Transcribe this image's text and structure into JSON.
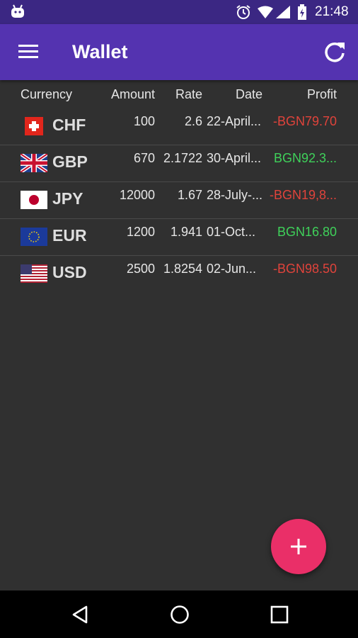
{
  "status_bar": {
    "time": "21:48",
    "icons": [
      "android-icon",
      "alarm-icon",
      "wifi-icon",
      "signal-icon",
      "battery-icon"
    ]
  },
  "app_bar": {
    "title": "Wallet",
    "menu_icon": "menu-icon",
    "refresh_icon": "refresh-icon"
  },
  "table": {
    "headers": {
      "currency": "Currency",
      "amount": "Amount",
      "rate": "Rate",
      "date": "Date",
      "profit": "Profit"
    },
    "rows": [
      {
        "flag": "swiss-flag-icon",
        "currency": "CHF",
        "amount": "100",
        "rate": "2.6",
        "date": "22-April...",
        "profit": "-BGN79.70",
        "profit_status": "negative"
      },
      {
        "flag": "uk-flag-icon",
        "currency": "GBP",
        "amount": "670",
        "rate": "2.1722",
        "date": "30-April...",
        "profit": "BGN92.3...",
        "profit_status": "positive"
      },
      {
        "flag": "japan-flag-icon",
        "currency": "JPY",
        "amount": "12000",
        "rate": "1.67",
        "date": "28-July-...",
        "profit": "-BGN19,8...",
        "profit_status": "negative"
      },
      {
        "flag": "eu-flag-icon",
        "currency": "EUR",
        "amount": "1200",
        "rate": "1.941",
        "date": "01-Oct...",
        "profit": "BGN16.80",
        "profit_status": "positive"
      },
      {
        "flag": "us-flag-icon",
        "currency": "USD",
        "amount": "2500",
        "rate": "1.8254",
        "date": "02-Jun...",
        "profit": "-BGN98.50",
        "profit_status": "negative"
      }
    ]
  },
  "fab": {
    "icon": "plus-icon"
  },
  "nav_bar": {
    "icons": [
      "back-icon",
      "home-icon",
      "recents-icon"
    ]
  },
  "colors": {
    "status_bar": "#3b2783",
    "app_bar": "#5433b0",
    "background": "#303030",
    "fab": "#ea2f68",
    "negative_profit": "#e0433b",
    "positive_profit": "#3fd15a"
  }
}
